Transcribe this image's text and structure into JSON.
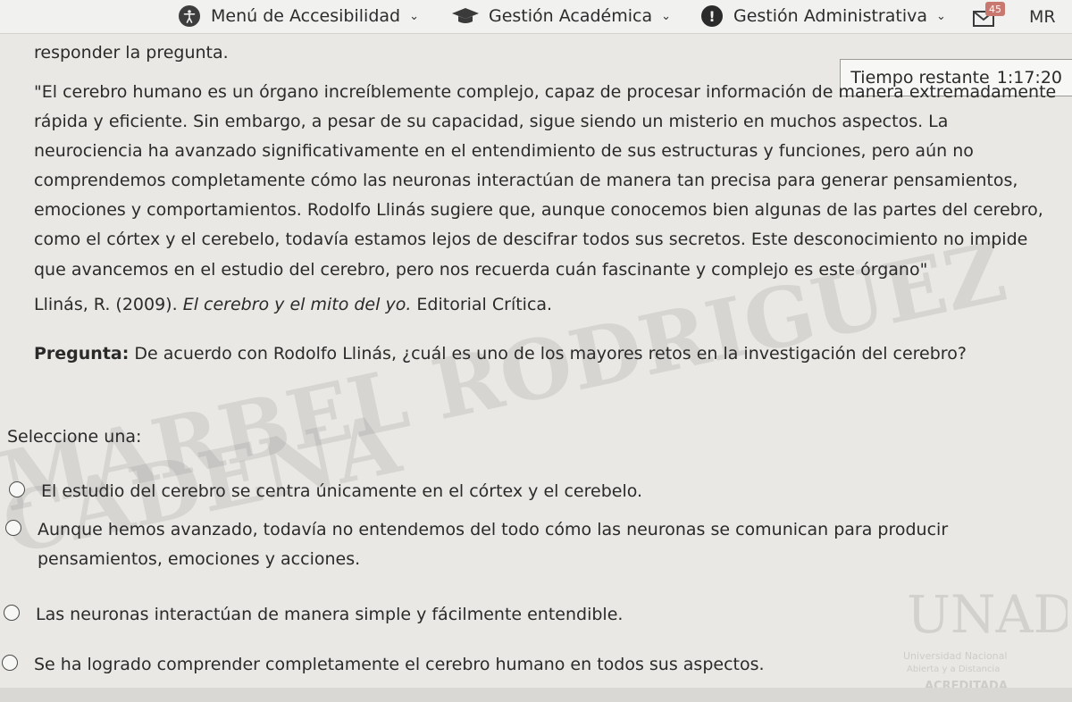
{
  "nav": {
    "accessibility_label": "Menú de Accesibilidad",
    "academic_label": "Gestión Académica",
    "admin_label": "Gestión Administrativa",
    "mail_badge": "45",
    "user_initials": "MR"
  },
  "timer": {
    "label": "Tiempo restante",
    "value": "1:17:20"
  },
  "intro": "responder la pregunta.",
  "passage": "\"El cerebro humano es un órgano increíblemente complejo, capaz de procesar información de manera extremadamente rápida y eficiente. Sin embargo, a pesar de su capacidad, sigue siendo un misterio en muchos aspectos. La neurociencia ha avanzado significativamente en el entendimiento de sus estructuras y funciones, pero aún no comprendemos completamente cómo las neuronas interactúan de manera tan precisa para generar pensamientos, emociones y comportamientos. Rodolfo Llinás sugiere que, aunque conocemos bien algunas de las partes del cerebro, como el córtex y el cerebelo, todavía estamos lejos de descifrar todos sus secretos. Este desconocimiento no impide que avancemos en el estudio del cerebro, pero nos recuerda cuán fascinante y complejo es este órgano\"",
  "citation": {
    "prefix": "Llinás, R. (2009).",
    "title": "El cerebro y el mito del yo.",
    "suffix": "Editorial Crítica."
  },
  "question": {
    "label": "Pregunta:",
    "text": "De acuerdo con Rodolfo Llinás, ¿cuál es uno de los mayores retos en la investigación del cerebro?"
  },
  "select_label": "Seleccione una:",
  "options": [
    "El estudio del cerebro se centra únicamente en el córtex y el cerebelo.",
    "Aunque hemos avanzado, todavía no entendemos del todo cómo las neuronas se comunican para producir pensamientos, emociones y acciones.",
    "Las neuronas interactúan de manera simple y fácilmente entendible.",
    "Se ha logrado comprender completamente el cerebro humano en todos sus aspectos."
  ],
  "watermarks": {
    "text_1": "MARBEL RODRIGUEZ",
    "text_2": "CADENA",
    "logo_text": "UNAD",
    "logo_sub_1": "Universidad Nacional",
    "logo_sub_2": "Abierta y a Distancia",
    "logo_badge": "ACREDITADA"
  },
  "colors": {
    "page_background": "#e9e8e4",
    "nav_background": "#f1f1ef",
    "badge": "#c9786f"
  },
  "icons": [
    "accessibility-icon",
    "chevron-down-icon",
    "graduation-cap-icon",
    "alert-icon",
    "mail-icon"
  ]
}
